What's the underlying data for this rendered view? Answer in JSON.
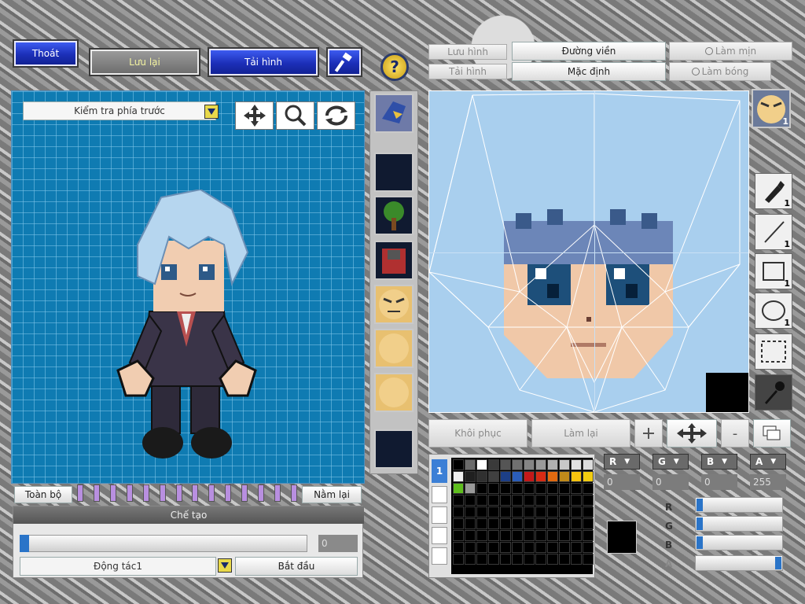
{
  "toolbar": {
    "exit": "Thoát",
    "save": "Lưu lại",
    "reload": "Tải hình",
    "help": "?"
  },
  "preview": {
    "view_select": "Kiểm tra phía trước",
    "all_btn": "Toàn bộ",
    "lie_btn": "Nằm lại",
    "create_label": "Chế tạo",
    "frame_value": "0",
    "motion_select": "Động tác1",
    "start_btn": "Bắt đầu"
  },
  "editor": {
    "save_image": "Lưu hình",
    "load_image": "Tải hình",
    "outline": "Đường viền",
    "default": "Mặc định",
    "smooth": "Làm mịn",
    "shine": "Làm bóng",
    "restore": "Khôi phục",
    "redo": "Làm lại",
    "minus": "-"
  },
  "palette": {
    "tab_label": "1",
    "colors": [
      "#000000",
      "#6b6b6b",
      "#ffffff",
      "#3a3a3a",
      "#555",
      "#707070",
      "#858585",
      "#9a9a9a",
      "#b0b0b0",
      "#c8c8c8",
      "#e2e2e2",
      "#dcdcdc",
      "#f0f0f0",
      "#202020",
      "#303030",
      "#404040",
      "#1d3f86",
      "#2b5db8",
      "#c41919",
      "#d62b14",
      "#e26a10",
      "#c08a1a",
      "#f7c30f",
      "#f2cc10",
      "#5fbe1e",
      "#9a9a9a"
    ]
  },
  "rgba": {
    "r_label": "R",
    "g_label": "G",
    "b_label": "B",
    "a_label": "A",
    "r_value": "0",
    "g_value": "0",
    "b_value": "0",
    "a_value": "255"
  },
  "right_tools": {
    "pen_count": "1",
    "line_count": "1",
    "rect_count": "1",
    "ellipse_count": "1",
    "face_count": "1"
  },
  "colors": {
    "accent_blue": "#1c2fb8",
    "preview_bg": "#0f7bb2",
    "canvas_bg": "#a9cfee"
  }
}
